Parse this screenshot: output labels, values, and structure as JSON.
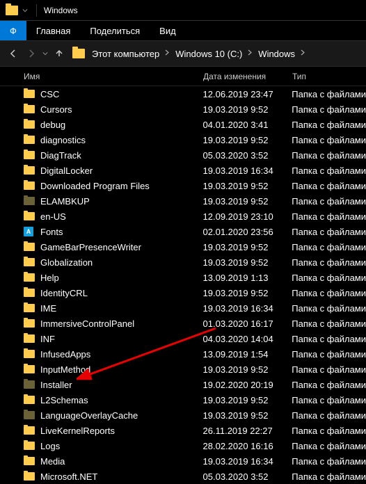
{
  "title": "Windows",
  "ribbon": {
    "file": "Ф",
    "tabs": [
      "Главная",
      "Поделиться",
      "Вид"
    ]
  },
  "breadcrumbs": [
    "Этот компьютер",
    "Windows 10 (C:)",
    "Windows"
  ],
  "columns": {
    "name": "Имя",
    "date": "Дата изменения",
    "type": "Тип"
  },
  "type_label": "Папка с файлами",
  "rows": [
    {
      "name": "CSC",
      "date": "12.06.2019 23:47",
      "icon": "yellow"
    },
    {
      "name": "Cursors",
      "date": "19.03.2019 9:52",
      "icon": "yellow"
    },
    {
      "name": "debug",
      "date": "04.01.2020 3:41",
      "icon": "yellow"
    },
    {
      "name": "diagnostics",
      "date": "19.03.2019 9:52",
      "icon": "yellow"
    },
    {
      "name": "DiagTrack",
      "date": "05.03.2020 3:52",
      "icon": "yellow"
    },
    {
      "name": "DigitalLocker",
      "date": "19.03.2019 16:34",
      "icon": "yellow"
    },
    {
      "name": "Downloaded Program Files",
      "date": "19.03.2019 9:52",
      "icon": "yellow"
    },
    {
      "name": "ELAMBKUP",
      "date": "19.03.2019 9:52",
      "icon": "dark"
    },
    {
      "name": "en-US",
      "date": "12.09.2019 23:10",
      "icon": "yellow"
    },
    {
      "name": "Fonts",
      "date": "02.01.2020 23:56",
      "icon": "font"
    },
    {
      "name": "GameBarPresenceWriter",
      "date": "19.03.2019 9:52",
      "icon": "yellow"
    },
    {
      "name": "Globalization",
      "date": "19.03.2019 9:52",
      "icon": "yellow"
    },
    {
      "name": "Help",
      "date": "13.09.2019 1:13",
      "icon": "yellow"
    },
    {
      "name": "IdentityCRL",
      "date": "19.03.2019 9:52",
      "icon": "yellow"
    },
    {
      "name": "IME",
      "date": "19.03.2019 16:34",
      "icon": "yellow"
    },
    {
      "name": "ImmersiveControlPanel",
      "date": "01.03.2020 16:17",
      "icon": "yellow"
    },
    {
      "name": "INF",
      "date": "04.03.2020 14:04",
      "icon": "yellow"
    },
    {
      "name": "InfusedApps",
      "date": "13.09.2019 1:54",
      "icon": "yellow"
    },
    {
      "name": "InputMethod",
      "date": "19.03.2019 9:52",
      "icon": "yellow"
    },
    {
      "name": "Installer",
      "date": "19.02.2020 20:19",
      "icon": "dark"
    },
    {
      "name": "L2Schemas",
      "date": "19.03.2019 9:52",
      "icon": "yellow"
    },
    {
      "name": "LanguageOverlayCache",
      "date": "19.03.2019 9:52",
      "icon": "dark"
    },
    {
      "name": "LiveKernelReports",
      "date": "26.11.2019 22:27",
      "icon": "yellow"
    },
    {
      "name": "Logs",
      "date": "28.02.2020 16:16",
      "icon": "yellow"
    },
    {
      "name": "Media",
      "date": "19.03.2019 16:34",
      "icon": "yellow"
    },
    {
      "name": "Microsoft.NET",
      "date": "05.03.2020 3:52",
      "icon": "yellow"
    }
  ],
  "annotation": {
    "target_row": "Installer"
  }
}
